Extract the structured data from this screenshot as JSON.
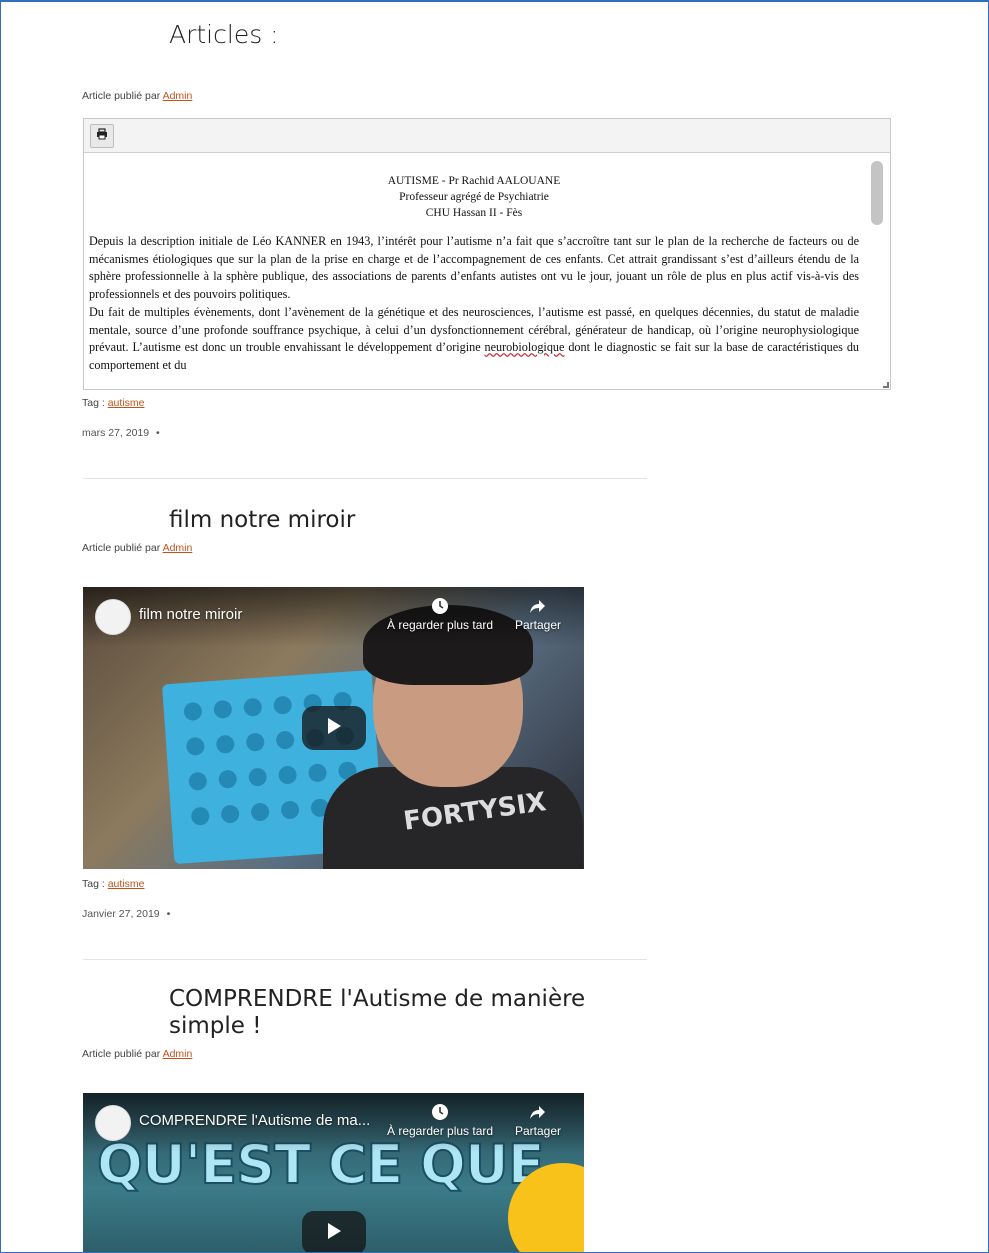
{
  "page": {
    "title": "Articles :"
  },
  "posts": [
    {
      "byline_prefix": "Article publié par",
      "author": "Admin",
      "document": {
        "header": [
          "AUTISME - Pr Rachid AALOUANE",
          "Professeur agrégé de Psychiatrie",
          "CHU Hassan II - Fès"
        ],
        "para1": "Depuis la description initiale de Léo KANNER en 1943, l’intérêt pour l’autisme n’a fait que s’accroître tant sur le plan de la recherche de facteurs ou de mécanismes étiologiques que sur la plan de la prise en charge et de l’accompagnement de ces enfants. Cet attrait grandissant s’est d’ailleurs étendu de la sphère professionnelle à la sphère publique, des associations de parents d’enfants autistes ont vu le jour, jouant un rôle de plus en plus actif vis-à-vis des professionnels et des pouvoirs politiques.",
        "para2_before": "Du fait de multiples évènements, dont l’avènement de la génétique et des neurosciences, l’autisme est passé, en quelques décennies, du statut de maladie mentale, source d’une profonde souffrance psychique, à celui d’un dysfonctionnement cérébral, générateur de handicap, où l’origine neurophysiologique prévaut. L’autisme est donc un trouble envahissant le développement d’origine ",
        "para2_underlined": "neurobiologique",
        "para2_after": " dont le diagnostic se fait sur la base de caractéristiques du comportement et du"
      },
      "tag_prefix": "Tag :",
      "tag": "autisme",
      "date": "mars 27, 2019",
      "date_suffix": "•"
    },
    {
      "title": "film notre miroir",
      "byline_prefix": "Article publié par",
      "author": "Admin",
      "video": {
        "title": "film notre miroir",
        "watch_later": "À regarder plus tard",
        "share": "Partager",
        "shirt_text": "FORTYSIX"
      },
      "tag_prefix": "Tag :",
      "tag": "autisme",
      "date": "Janvier 27, 2019",
      "date_suffix": "•"
    },
    {
      "title": "COMPRENDRE l'Autisme de manière simple !",
      "byline_prefix": "Article publié par",
      "author": "Admin",
      "video": {
        "title": "COMPRENDRE l'Autisme de ma...",
        "watch_later": "À regarder plus tard",
        "share": "Partager",
        "overlay_text": "QU'EST CE QUE"
      }
    }
  ],
  "colors": {
    "link": "#c0531b",
    "frame": "#2f6fbf"
  },
  "icons": [
    "print-icon",
    "clock-icon",
    "share-icon",
    "play-icon"
  ]
}
